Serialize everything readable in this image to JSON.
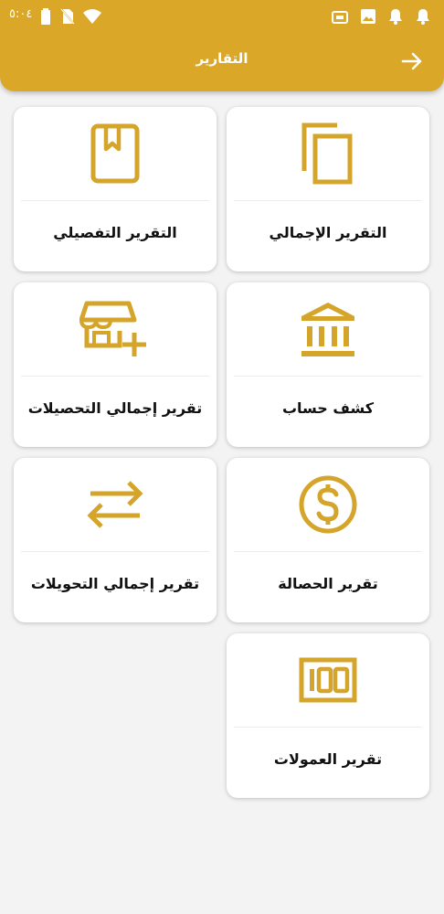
{
  "status_bar": {
    "time": "٥:٠٤",
    "icons": [
      "battery-icon",
      "no-sim-icon",
      "wifi-icon",
      "app-notification-icon",
      "image-icon",
      "bell-icon",
      "bell-icon"
    ]
  },
  "header": {
    "title": "التقارير",
    "back_icon": "arrow-right-icon",
    "background": "#daa728"
  },
  "accent_color": "#d4a52a",
  "cards": [
    {
      "label": "التقرير الإجمالي",
      "icon": "copy-icon"
    },
    {
      "label": "التقرير التفصيلي",
      "icon": "bookmark-book-icon"
    },
    {
      "label": "كشف حساب",
      "icon": "bank-icon"
    },
    {
      "label": "تقرير إجمالي التحصيلات",
      "icon": "store-add-icon"
    },
    {
      "label": "تقرير الحصالة",
      "icon": "dollar-coin-icon"
    },
    {
      "label": "تقرير إجمالي التحويلات",
      "icon": "swap-arrows-icon"
    },
    {
      "label": "تقرير العمولات",
      "icon": "hundred-icon"
    }
  ]
}
